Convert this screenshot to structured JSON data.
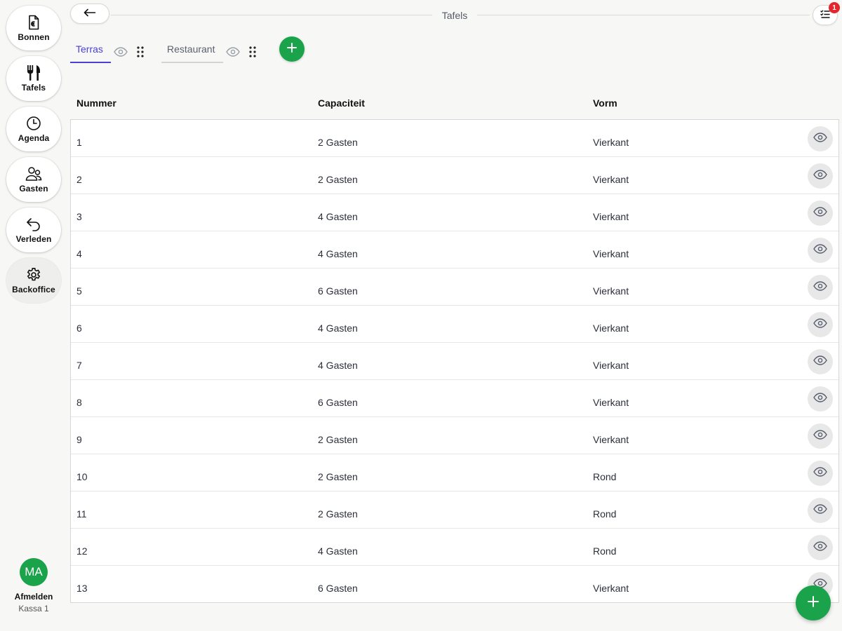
{
  "sidebar": {
    "items": [
      {
        "label": "Bonnen",
        "icon": "receipt-euro-icon"
      },
      {
        "label": "Tafels",
        "icon": "fork-knife-icon"
      },
      {
        "label": "Agenda",
        "icon": "clock-icon"
      },
      {
        "label": "Gasten",
        "icon": "users-icon"
      },
      {
        "label": "Verleden",
        "icon": "undo-arrow-icon"
      },
      {
        "label": "Backoffice",
        "icon": "gear-icon"
      }
    ],
    "user": {
      "initials": "MA",
      "logout_label": "Afmelden",
      "register": "Kassa 1"
    }
  },
  "header": {
    "title": "Tafels",
    "back_icon": "arrow-left-icon",
    "list_icon": "checklist-icon",
    "badge_count": "1"
  },
  "tabs": [
    {
      "label": "Terras",
      "active": true
    },
    {
      "label": "Restaurant",
      "active": false
    }
  ],
  "table": {
    "columns": [
      "Nummer",
      "Capaciteit",
      "Vorm"
    ],
    "rows": [
      {
        "nummer": "1",
        "capaciteit": "2 Gasten",
        "vorm": "Vierkant"
      },
      {
        "nummer": "2",
        "capaciteit": "2 Gasten",
        "vorm": "Vierkant"
      },
      {
        "nummer": "3",
        "capaciteit": "4 Gasten",
        "vorm": "Vierkant"
      },
      {
        "nummer": "4",
        "capaciteit": "4 Gasten",
        "vorm": "Vierkant"
      },
      {
        "nummer": "5",
        "capaciteit": "6 Gasten",
        "vorm": "Vierkant"
      },
      {
        "nummer": "6",
        "capaciteit": "4 Gasten",
        "vorm": "Vierkant"
      },
      {
        "nummer": "7",
        "capaciteit": "4 Gasten",
        "vorm": "Vierkant"
      },
      {
        "nummer": "8",
        "capaciteit": "6 Gasten",
        "vorm": "Vierkant"
      },
      {
        "nummer": "9",
        "capaciteit": "2 Gasten",
        "vorm": "Vierkant"
      },
      {
        "nummer": "10",
        "capaciteit": "2 Gasten",
        "vorm": "Rond"
      },
      {
        "nummer": "11",
        "capaciteit": "2 Gasten",
        "vorm": "Rond"
      },
      {
        "nummer": "12",
        "capaciteit": "4 Gasten",
        "vorm": "Rond"
      },
      {
        "nummer": "13",
        "capaciteit": "6 Gasten",
        "vorm": "Vierkant"
      }
    ]
  },
  "colors": {
    "accent": "#4a3fd6",
    "primary_green": "#1aa34a",
    "badge_red": "#e5252a"
  }
}
